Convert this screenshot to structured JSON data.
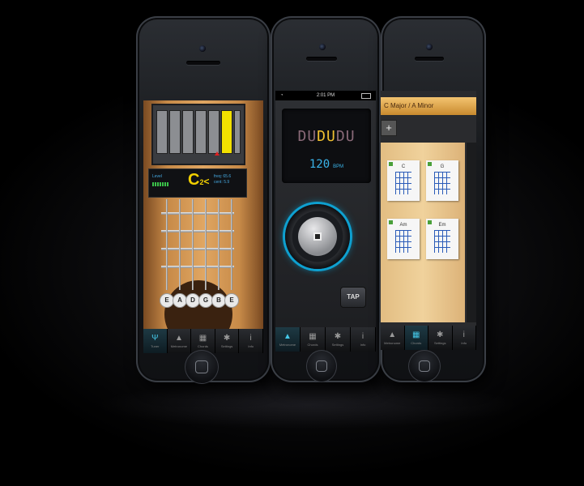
{
  "tabs": [
    {
      "label": "Tuner",
      "icon": "tuning-fork-icon"
    },
    {
      "label": "Metronome",
      "icon": "metronome-icon"
    },
    {
      "label": "Chords",
      "icon": "chord-grid-icon"
    },
    {
      "label": "Settings",
      "icon": "gear-icon"
    },
    {
      "label": "Info",
      "icon": "info-icon"
    }
  ],
  "tuner": {
    "level_label": "Level",
    "note": "C",
    "note_suffix": "2",
    "note_arrow": "<",
    "freq_label": "freq:",
    "freq_value": "65.6",
    "cent_label": "cent:",
    "cent_value": "5.9",
    "strings": [
      "E",
      "A",
      "D",
      "G",
      "B",
      "E"
    ],
    "active_tab": "Tuner",
    "meter_active_bar": 5
  },
  "metronome": {
    "status_time": "2:01 PM",
    "pattern": [
      "D",
      "U",
      "D",
      "U",
      "D",
      "U"
    ],
    "highlight_indices": [
      2,
      3
    ],
    "bpm_value": "120",
    "bpm_unit": "BPM",
    "tap_label": "TAP",
    "active_tab": "Metronome"
  },
  "chords": {
    "key_label": "C Major / A Minor",
    "add_label": "+",
    "cards": [
      "C",
      "G",
      "Am",
      "Em"
    ],
    "active_tab": "Chords"
  },
  "colors": {
    "accent_cyan": "#45c8e8",
    "meter_yellow": "#f2e000",
    "beat_highlight": "#f0c030",
    "bpm_blue": "#3ab4ea",
    "key_bar": "#f4c470"
  }
}
